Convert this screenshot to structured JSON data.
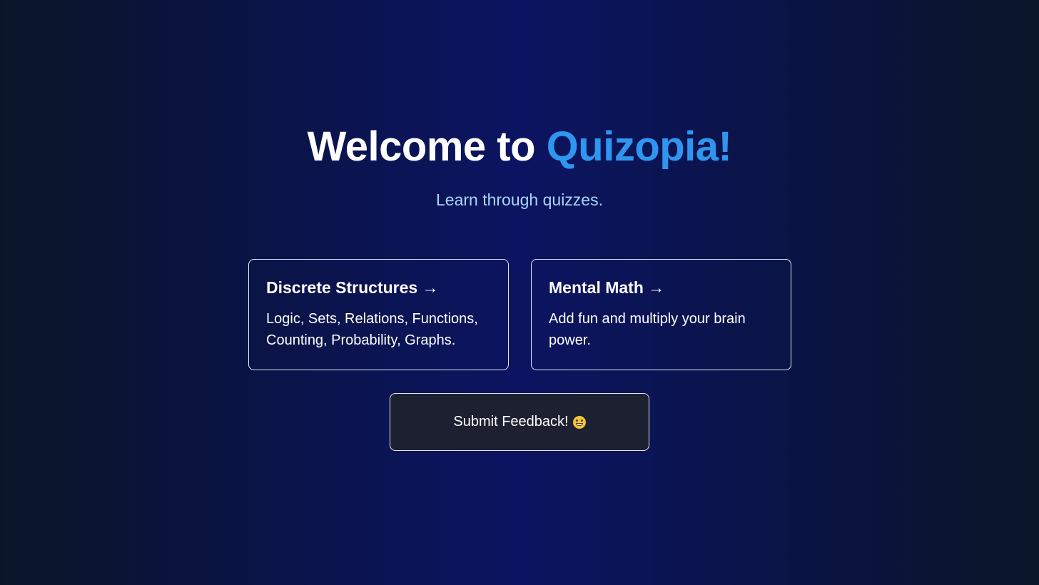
{
  "hero": {
    "title_prefix": "Welcome to ",
    "title_brand": "Quizopia!",
    "subtitle": "Learn through quizzes."
  },
  "cards": [
    {
      "title": "Discrete Structures →",
      "description": "Logic, Sets, Relations, Functions, Counting, Probability, Graphs."
    },
    {
      "title": "Mental Math →",
      "description": "Add fun and multiply your brain power."
    }
  ],
  "feedback": {
    "label": "Submit Feedback!",
    "icon": "grinning-face-emoji"
  },
  "colors": {
    "brand": "#2f96f0",
    "subtitle": "#a9d6f7",
    "background_center": "#0c1462",
    "background_edge": "#0a1628",
    "button_bg": "#1c2030"
  }
}
